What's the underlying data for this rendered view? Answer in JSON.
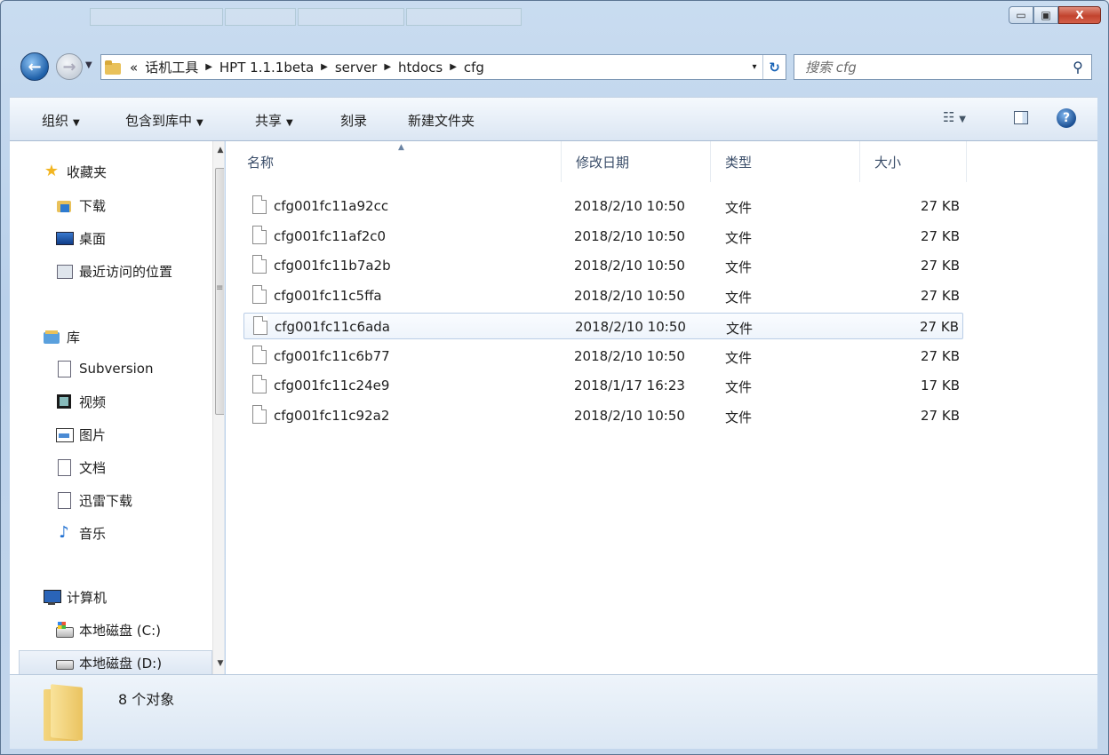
{
  "window": {
    "controls": {
      "minimize": "▭",
      "maximize": "▣",
      "close": "X"
    }
  },
  "address_bar": {
    "overflow": "«",
    "crumbs": [
      "话机工具",
      "HPT 1.1.1beta",
      "server",
      "htdocs",
      "cfg"
    ],
    "dropdown": "▾",
    "refresh_icon": "↻"
  },
  "search": {
    "placeholder": "搜索 cfg"
  },
  "toolbar": {
    "organize": "组织",
    "include_in_library": "包含到库中",
    "share": "共享",
    "burn": "刻录",
    "new_folder": "新建文件夹"
  },
  "navpane": {
    "favorites": {
      "label": "收藏夹",
      "icon": "star-icon"
    },
    "favorites_items": [
      {
        "label": "下载",
        "icon": "downloads-folder-icon"
      },
      {
        "label": "桌面",
        "icon": "desktop-icon"
      },
      {
        "label": "最近访问的位置",
        "icon": "recent-places-icon"
      }
    ],
    "libraries": {
      "label": "库",
      "icon": "library-icon"
    },
    "library_items": [
      {
        "label": "Subversion",
        "icon": "document-icon"
      },
      {
        "label": "视频",
        "icon": "video-icon"
      },
      {
        "label": "图片",
        "icon": "pictures-icon"
      },
      {
        "label": "文档",
        "icon": "document-icon"
      },
      {
        "label": "迅雷下载",
        "icon": "document-icon"
      },
      {
        "label": "音乐",
        "icon": "music-icon"
      }
    ],
    "computer": {
      "label": "计算机",
      "icon": "computer-icon"
    },
    "computer_items": [
      {
        "label": "本地磁盘 (C:)",
        "icon": "system-drive-icon"
      },
      {
        "label": "本地磁盘 (D:)",
        "icon": "drive-icon"
      }
    ]
  },
  "columns": {
    "name": "名称",
    "modified": "修改日期",
    "type": "类型",
    "size": "大小"
  },
  "files": [
    {
      "name": "cfg001fc11a92cc",
      "modified": "2018/2/10 10:50",
      "type": "文件",
      "size": "27 KB"
    },
    {
      "name": "cfg001fc11af2c0",
      "modified": "2018/2/10 10:50",
      "type": "文件",
      "size": "27 KB"
    },
    {
      "name": "cfg001fc11b7a2b",
      "modified": "2018/2/10 10:50",
      "type": "文件",
      "size": "27 KB"
    },
    {
      "name": "cfg001fc11c5ffa",
      "modified": "2018/2/10 10:50",
      "type": "文件",
      "size": "27 KB"
    },
    {
      "name": "cfg001fc11c6ada",
      "modified": "2018/2/10 10:50",
      "type": "文件",
      "size": "27 KB",
      "hovered": true
    },
    {
      "name": "cfg001fc11c6b77",
      "modified": "2018/2/10 10:50",
      "type": "文件",
      "size": "27 KB"
    },
    {
      "name": "cfg001fc11c24e9",
      "modified": "2018/1/17 16:23",
      "type": "文件",
      "size": "17 KB"
    },
    {
      "name": "cfg001fc11c92a2",
      "modified": "2018/2/10 10:50",
      "type": "文件",
      "size": "27 KB"
    }
  ],
  "details": {
    "count_text": "8 个对象"
  },
  "colors": {
    "hover_border": "#b9cde6",
    "header_text": "#3a4d69",
    "accent_blue": "#1e5fa8"
  }
}
